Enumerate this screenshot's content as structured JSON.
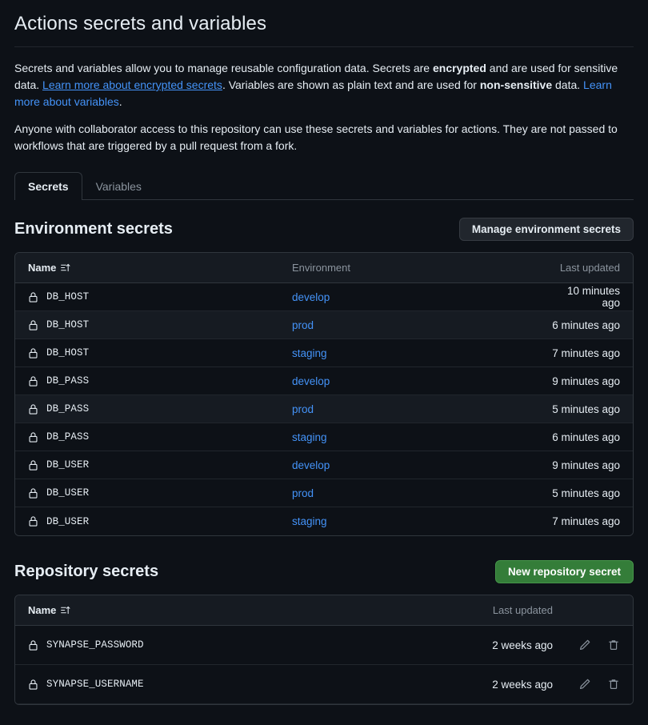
{
  "page": {
    "title": "Actions secrets and variables"
  },
  "description": {
    "p1_part1": "Secrets and variables allow you to manage reusable configuration data. Secrets are ",
    "p1_bold1": "encrypted",
    "p1_part2": " and are used for sensitive data. ",
    "p1_link1": "Learn more about encrypted secrets",
    "p1_part3": ". Variables are shown as plain text and are used for ",
    "p1_bold2": "non-sensitive",
    "p1_part4": " data. ",
    "p1_link2": "Learn more about variables",
    "p1_part5": ".",
    "p2": "Anyone with collaborator access to this repository can use these secrets and variables for actions. They are not passed to workflows that are triggered by a pull request from a fork."
  },
  "tabs": [
    {
      "label": "Secrets",
      "active": true
    },
    {
      "label": "Variables",
      "active": false
    }
  ],
  "environment_section": {
    "title": "Environment secrets",
    "button_label": "Manage environment secrets",
    "columns": {
      "name": "Name",
      "environment": "Environment",
      "last_updated": "Last updated"
    },
    "sort_icon": "sort-ascending-icon",
    "rows": [
      {
        "icon": "lock-icon",
        "name": "DB_HOST",
        "environment": "develop",
        "last_updated": "10 minutes ago"
      },
      {
        "icon": "lock-icon",
        "name": "DB_HOST",
        "environment": "prod",
        "last_updated": "6 minutes ago"
      },
      {
        "icon": "lock-icon",
        "name": "DB_HOST",
        "environment": "staging",
        "last_updated": "7 minutes ago"
      },
      {
        "icon": "lock-icon",
        "name": "DB_PASS",
        "environment": "develop",
        "last_updated": "9 minutes ago"
      },
      {
        "icon": "lock-icon",
        "name": "DB_PASS",
        "environment": "prod",
        "last_updated": "5 minutes ago"
      },
      {
        "icon": "lock-icon",
        "name": "DB_PASS",
        "environment": "staging",
        "last_updated": "6 minutes ago"
      },
      {
        "icon": "lock-icon",
        "name": "DB_USER",
        "environment": "develop",
        "last_updated": "9 minutes ago"
      },
      {
        "icon": "lock-icon",
        "name": "DB_USER",
        "environment": "prod",
        "last_updated": "5 minutes ago"
      },
      {
        "icon": "lock-icon",
        "name": "DB_USER",
        "environment": "staging",
        "last_updated": "7 minutes ago"
      }
    ]
  },
  "repository_section": {
    "title": "Repository secrets",
    "button_label": "New repository secret",
    "columns": {
      "name": "Name",
      "last_updated": "Last updated"
    },
    "sort_icon": "sort-ascending-icon",
    "rows": [
      {
        "icon": "lock-icon",
        "name": "SYNAPSE_PASSWORD",
        "last_updated": "2 weeks ago",
        "edit_icon": "pencil-icon",
        "delete_icon": "trash-icon"
      },
      {
        "icon": "lock-icon",
        "name": "SYNAPSE_USERNAME",
        "last_updated": "2 weeks ago",
        "edit_icon": "pencil-icon",
        "delete_icon": "trash-icon"
      }
    ]
  },
  "colors": {
    "background": "#0d1117",
    "link": "#4493f8",
    "primary_button": "#347d39",
    "border": "#30363d",
    "row_alt": "#161b22",
    "muted_text": "#8b949e"
  }
}
